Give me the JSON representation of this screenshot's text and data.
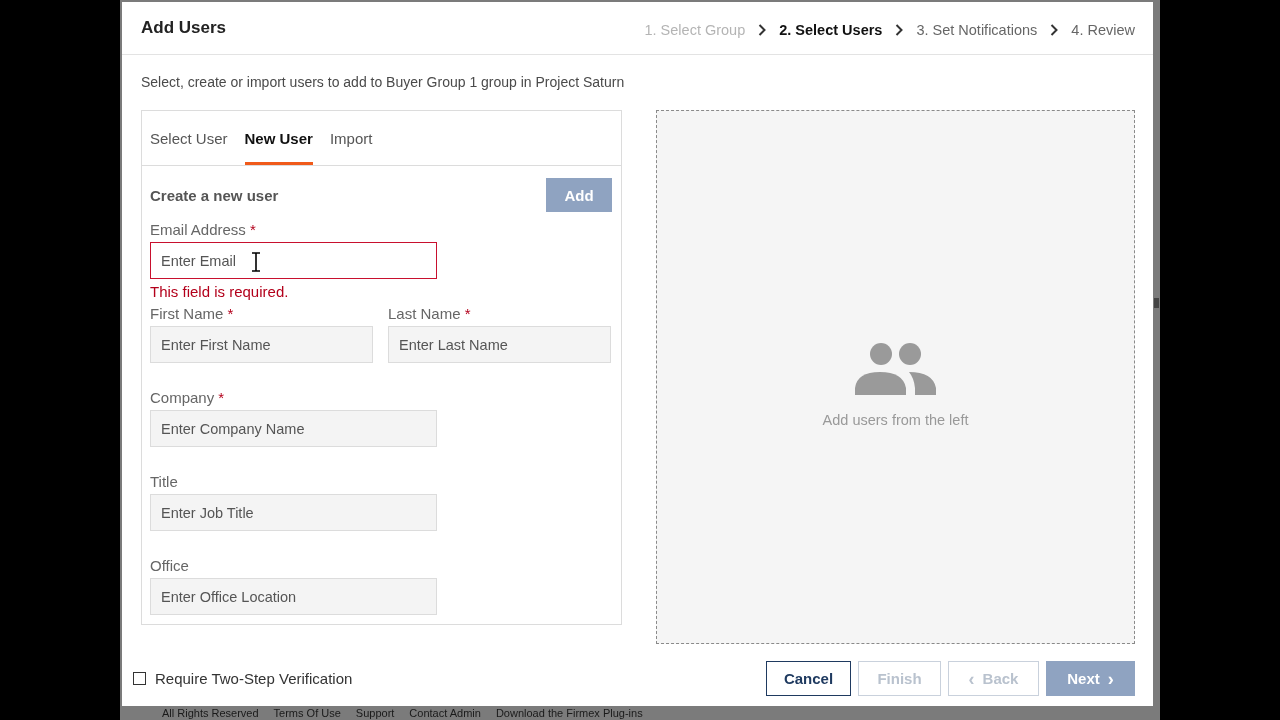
{
  "dialog": {
    "title": "Add Users"
  },
  "steps": [
    {
      "label": "1. Select Group",
      "selected": false,
      "completed": true
    },
    {
      "label": "2. Select Users",
      "selected": true,
      "completed": false
    },
    {
      "label": "3. Set Notifications",
      "selected": false,
      "completed": false
    },
    {
      "label": "4. Review",
      "selected": false,
      "completed": false
    }
  ],
  "instruction": "Select, create or import users to add to Buyer Group 1 group in Project Saturn",
  "tabs": [
    {
      "label": "Select User",
      "selected": false
    },
    {
      "label": "New User",
      "selected": true
    },
    {
      "label": "Import",
      "selected": false
    }
  ],
  "form": {
    "heading": "Create a new user",
    "add_button": {
      "label": "Add",
      "kind": "primary",
      "disabled": true
    },
    "rows": [
      [
        {
          "label": "Email Address",
          "required_mark": "*",
          "placeholder": "Enter Email",
          "error": "This field is required.",
          "hovered": true
        }
      ],
      [
        {
          "label": "First Name",
          "required_mark": "*",
          "placeholder": "Enter First Name",
          "hovered": false
        },
        {
          "label": "Last Name",
          "required_mark": "*",
          "placeholder": "Enter Last Name",
          "hovered": false
        }
      ],
      [
        {
          "label": "Company",
          "required_mark": "*",
          "placeholder": "Enter Company Name",
          "hovered": false
        }
      ],
      [
        {
          "label": "Title",
          "placeholder": "Enter Job Title",
          "hovered": false
        }
      ],
      [
        {
          "label": "Office",
          "placeholder": "Enter Office Location",
          "hovered": false
        }
      ]
    ]
  },
  "selected_users": {
    "empty_text": "Add users from the left"
  },
  "two_step": {
    "label": "Require Two-Step Verification",
    "checked": false
  },
  "buttons": [
    {
      "label": "Cancel",
      "kind": "secondary",
      "disabled": false
    },
    {
      "label": "Finish",
      "kind": "secondary",
      "disabled": true
    },
    {
      "label": "Back",
      "kind": "secondary",
      "disabled": true,
      "icon_before": "‹"
    },
    {
      "label": "Next",
      "kind": "primary",
      "disabled": true,
      "icon_after": "›"
    }
  ],
  "page_footer": [
    "All Rights Reserved",
    "Terms Of Use",
    "Support",
    "Contact Admin",
    "Download the Firmex Plug-ins"
  ]
}
